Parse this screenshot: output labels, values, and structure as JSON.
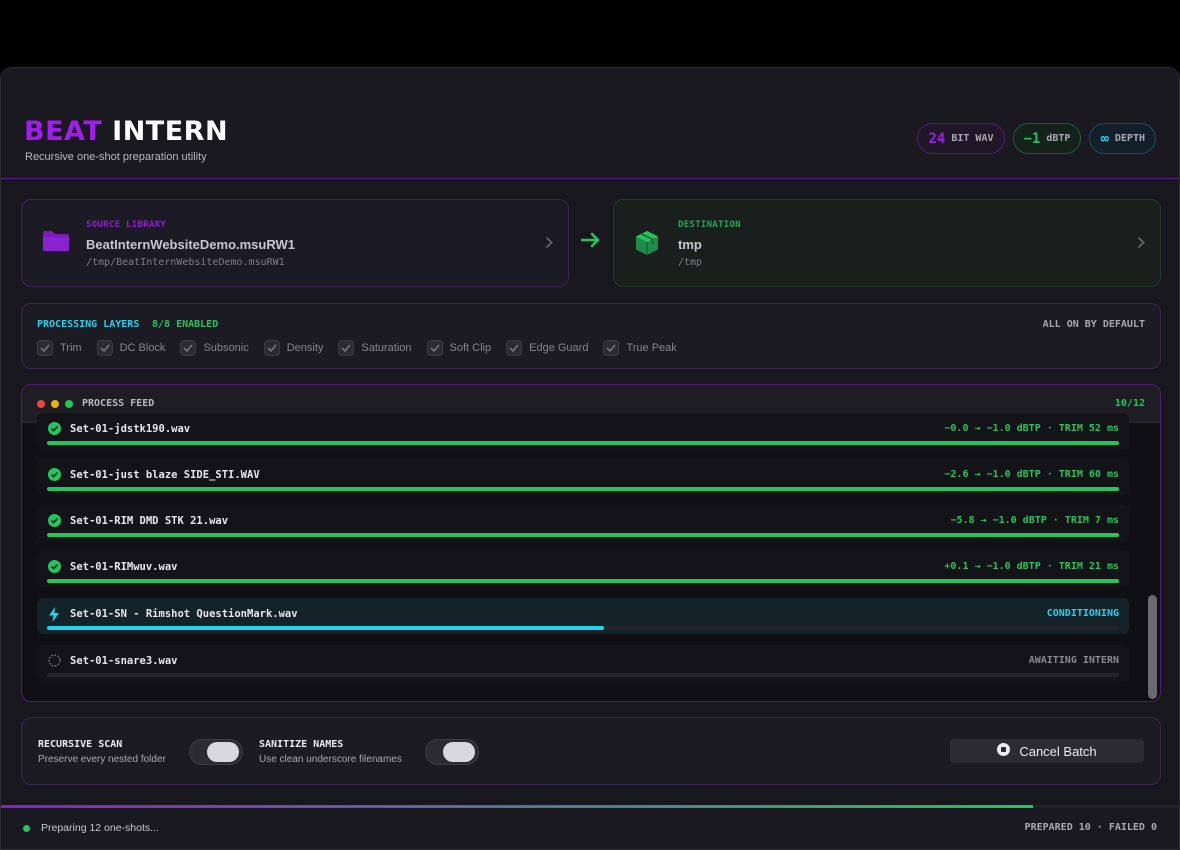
{
  "window": {
    "title": "",
    "traffic_lights": [
      "close",
      "minimize",
      "zoom"
    ]
  },
  "header": {
    "brand_part1": "BEAT",
    "brand_part2": "INTERN",
    "subtitle": "Recursive one-shot preparation utility",
    "pills": [
      {
        "value": "24",
        "label": "BIT WAV",
        "color": "#a21cf0"
      },
      {
        "value": "−1",
        "label": "dBTP",
        "color": "#22c55e"
      },
      {
        "value": "∞",
        "label": "DEPTH",
        "color": "#22d3ee"
      }
    ]
  },
  "source": {
    "label": "SOURCE LIBRARY",
    "name": "BeatInternWebsiteDemo.msuRW1",
    "path": "/tmp/BeatInternWebsiteDemo.msuRW1",
    "icon": "folder-icon"
  },
  "destination": {
    "label": "DESTINATION",
    "name": "tmp",
    "path": "/tmp",
    "icon": "package-icon"
  },
  "layers": {
    "title": "PROCESSING LAYERS",
    "enabled": "8/8 ENABLED",
    "default_note": "ALL ON BY DEFAULT",
    "items": [
      "Trim",
      "DC Block",
      "Subsonic",
      "Density",
      "Saturation",
      "Soft Clip",
      "Edge Guard",
      "True Peak"
    ]
  },
  "feed": {
    "title": "PROCESS FEED",
    "count": "10/12",
    "rows": [
      {
        "file": "Set-01-jdstk190.wav",
        "status": "−0.0 → −1.0 dBTP  ·  TRIM 52 ms",
        "state": "done",
        "progress": 1.0
      },
      {
        "file": "Set-01-just blaze SIDE_STI.WAV",
        "status": "−2.6 → −1.0 dBTP  ·  TRIM 60 ms",
        "state": "done",
        "progress": 1.0
      },
      {
        "file": "Set-01-RIM DMD STK 21.wav",
        "status": "−5.8 → −1.0 dBTP  ·  TRIM 7 ms",
        "state": "done",
        "progress": 1.0
      },
      {
        "file": "Set-01-RIMwuv.wav",
        "status": "+0.1 → −1.0 dBTP  ·  TRIM 21 ms",
        "state": "done",
        "progress": 1.0
      },
      {
        "file": "Set-01-SN - Rimshot QuestionMark.wav",
        "status": "CONDITIONING",
        "state": "active",
        "progress": 0.52
      },
      {
        "file": "Set-01-snare3.wav",
        "status": "AWAITING INTERN",
        "state": "pending",
        "progress": 0.0
      }
    ]
  },
  "controls": {
    "recursive_label": "RECURSIVE SCAN",
    "recursive_sub": "Preserve every nested folder",
    "recursive_on": true,
    "sanitize_label": "SANITIZE NAMES",
    "sanitize_sub": "Use clean underscore filenames",
    "sanitize_on": true,
    "cancel_label": "Cancel Batch"
  },
  "overall_progress": 0.876,
  "footer": {
    "message": "Preparing 12 one-shots...",
    "stats": "PREPARED 10  ·  FAILED 0"
  },
  "colors": {
    "purple": "#a21cf0",
    "green": "#22c55e",
    "cyan": "#22d3ee"
  }
}
